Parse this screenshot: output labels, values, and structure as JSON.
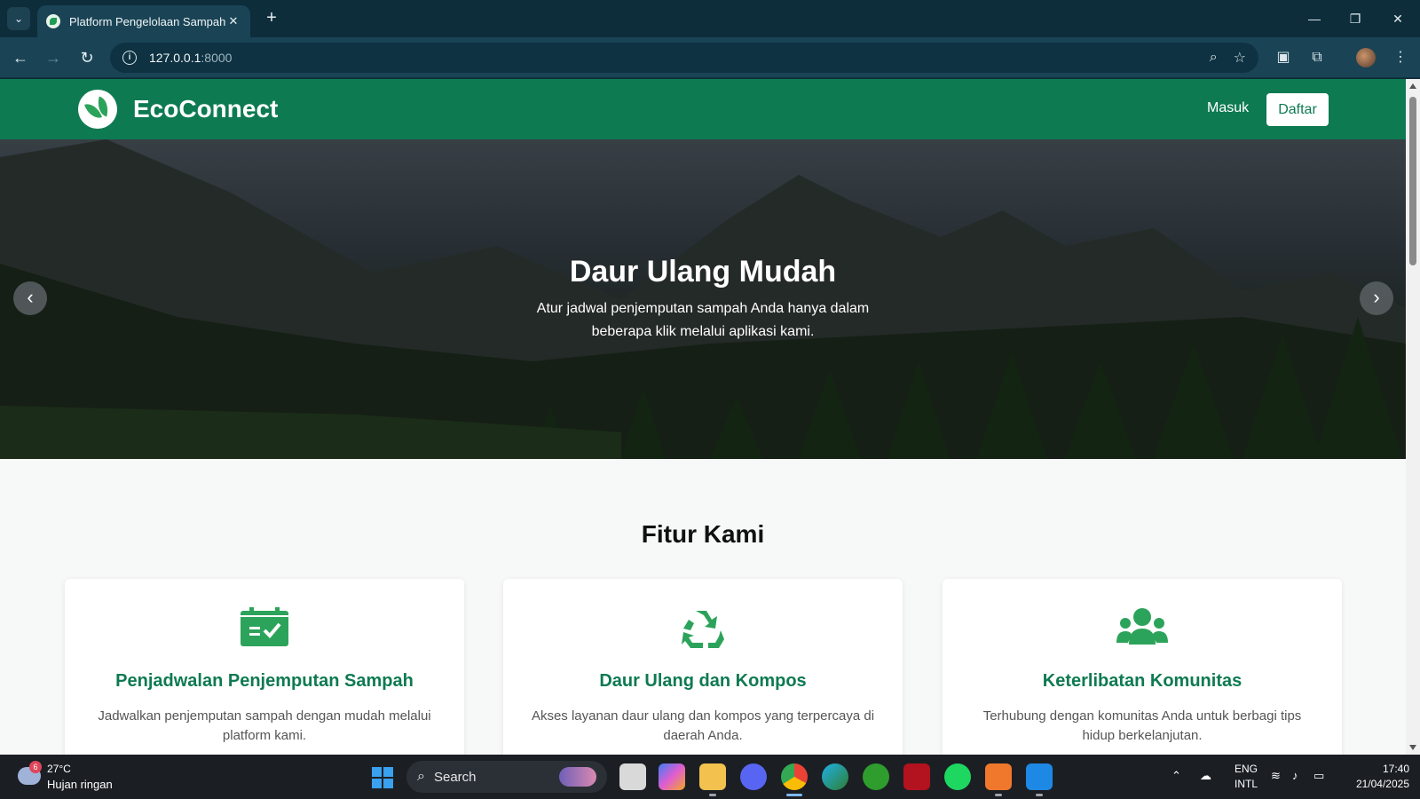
{
  "browser": {
    "tab_title": "Platform Pengelolaan Sampah",
    "tab_close": "✕",
    "new_tab": "+",
    "url_host": "127.0.0.1",
    "url_port": ":8000",
    "window_controls": {
      "minimize": "—",
      "restore": "❐",
      "close": "✕"
    }
  },
  "site": {
    "brand": "EcoConnect",
    "nav": {
      "login": "Masuk",
      "register": "Daftar"
    },
    "hero": {
      "title": "Daur Ulang Mudah",
      "subtitle": "Atur jadwal penjemputan sampah Anda hanya dalam beberapa klik melalui aplikasi kami.",
      "prev": "‹",
      "next": "›"
    },
    "features": {
      "title": "Fitur Kami",
      "cards": [
        {
          "icon": "calendar-check-icon",
          "title": "Penjadwalan Penjemputan Sampah",
          "desc": "Jadwalkan penjemputan sampah dengan mudah melalui platform kami."
        },
        {
          "icon": "recycle-icon",
          "title": "Daur Ulang dan Kompos",
          "desc": "Akses layanan daur ulang dan kompos yang terpercaya di daerah Anda."
        },
        {
          "icon": "users-icon",
          "title": "Keterlibatan Komunitas",
          "desc": "Terhubung dengan komunitas Anda untuk berbagi tips hidup berkelanjutan."
        }
      ]
    },
    "colors": {
      "primary": "#0e7a52",
      "icon_green": "#2ca35a"
    }
  },
  "taskbar": {
    "weather_badge": "6",
    "weather_temp": "27°C",
    "weather_desc": "Hujan ringan",
    "search_label": "Search",
    "lang_top": "ENG",
    "lang_bottom": "INTL",
    "time": "17:40",
    "date": "21/04/2025"
  }
}
